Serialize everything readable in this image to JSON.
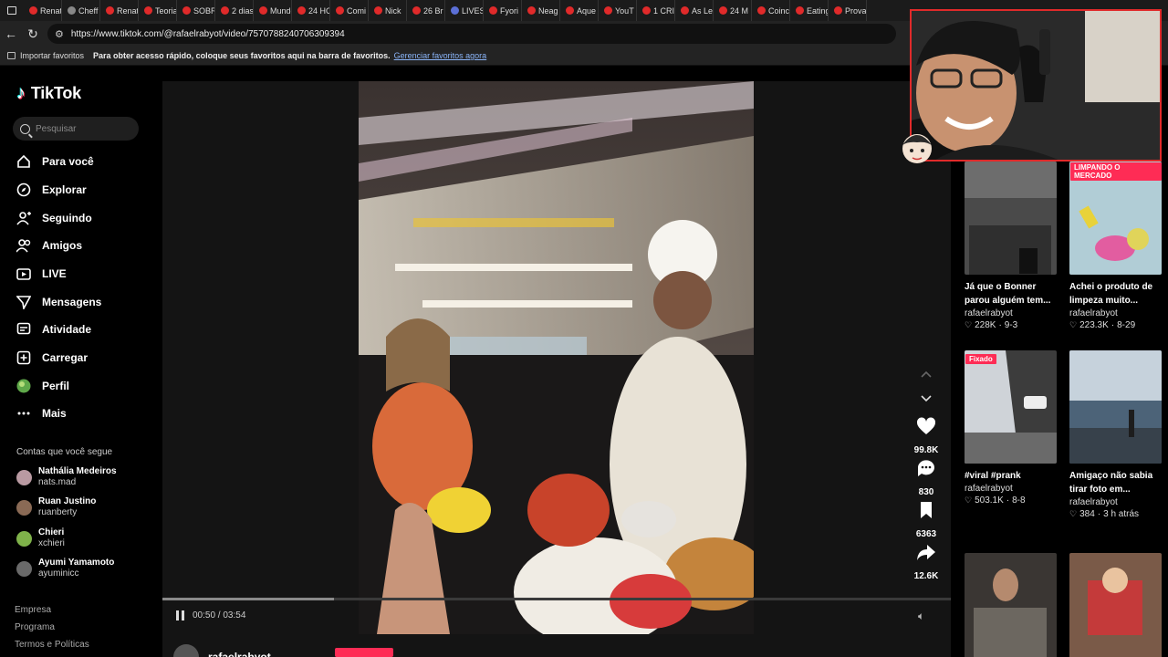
{
  "browser": {
    "tabs": [
      {
        "label": "Renat",
        "color": "#e02a2a"
      },
      {
        "label": "Cheff",
        "color": "#888888"
      },
      {
        "label": "Renat",
        "color": "#e02a2a"
      },
      {
        "label": "Teoria",
        "color": "#e02a2a"
      },
      {
        "label": "SOBR",
        "color": "#e02a2a"
      },
      {
        "label": "2 dias",
        "color": "#e02a2a"
      },
      {
        "label": "Mundo",
        "color": "#e02a2a"
      },
      {
        "label": "24 HO",
        "color": "#e02a2a"
      },
      {
        "label": "Comi",
        "color": "#e02a2a"
      },
      {
        "label": "Nick",
        "color": "#e02a2a"
      },
      {
        "label": "26 Br",
        "color": "#e02a2a"
      },
      {
        "label": "LIVES",
        "color": "#5b6fd6"
      },
      {
        "label": "Fyori",
        "color": "#e02a2a"
      },
      {
        "label": "Neag",
        "color": "#e02a2a"
      },
      {
        "label": "Aque",
        "color": "#e02a2a"
      },
      {
        "label": "YouT",
        "color": "#e02a2a"
      },
      {
        "label": "1 CRI",
        "color": "#e02a2a"
      },
      {
        "label": "As Le",
        "color": "#e02a2a"
      },
      {
        "label": "24 M",
        "color": "#e02a2a"
      },
      {
        "label": "Coinc",
        "color": "#e02a2a"
      },
      {
        "label": "Eating",
        "color": "#e02a2a"
      },
      {
        "label": "Prova",
        "color": "#e02a2a"
      }
    ],
    "url": "https://www.tiktok.com/@rafaelrabyot/video/7570788240706309394",
    "bookmarks": {
      "import_label": "Importar favoritos",
      "prompt": "Para obter acesso rápido, coloque seus favoritos aqui na barra de favoritos.",
      "manage_link": "Gerenciar favoritos agora"
    }
  },
  "sidebar": {
    "brand": "TikTok",
    "search_placeholder": "Pesquisar",
    "nav": [
      {
        "label": "Para você",
        "icon": "home-icon"
      },
      {
        "label": "Explorar",
        "icon": "compass-icon"
      },
      {
        "label": "Seguindo",
        "icon": "user-follow-icon"
      },
      {
        "label": "Amigos",
        "icon": "friends-icon"
      },
      {
        "label": "LIVE",
        "icon": "live-tv-icon"
      },
      {
        "label": "Mensagens",
        "icon": "send-icon"
      },
      {
        "label": "Atividade",
        "icon": "activity-icon"
      },
      {
        "label": "Carregar",
        "icon": "upload-plus-icon"
      },
      {
        "label": "Perfil",
        "icon": "profile-avatar-icon"
      },
      {
        "label": "Mais",
        "icon": "more-dots-icon"
      }
    ],
    "following_title": "Contas que você segue",
    "following": [
      {
        "name": "Nathália Medeiros",
        "username": "nats.mad",
        "color": "#b99aa2"
      },
      {
        "name": "Ruan Justino",
        "username": "ruanberty",
        "color": "#8a6a55"
      },
      {
        "name": "Chieri",
        "username": "xchieri",
        "color": "#7fb24a"
      },
      {
        "name": "Ayumi Yamamoto",
        "username": "ayuminicc",
        "color": "#6a6a6a"
      }
    ],
    "footer": [
      "Empresa",
      "Programa",
      "Termos e Políticas"
    ]
  },
  "player": {
    "time": "00:50 / 03:54",
    "progress": 0.218,
    "author": "rafaelrabyot"
  },
  "actions": [
    {
      "icon": "heart-icon",
      "count": "99.8K"
    },
    {
      "icon": "comment-icon",
      "count": "830"
    },
    {
      "icon": "bookmark-icon",
      "count": "6363"
    },
    {
      "icon": "share-icon",
      "count": "12.6K"
    }
  ],
  "videos": [
    {
      "title": "Já que o Bonner parou alguém tem...",
      "author": "rafaelrabyot",
      "likes": "228K",
      "date": "9-3",
      "badge": "",
      "overlay": ""
    },
    {
      "title": "Achei o produto de limpeza muito...",
      "author": "rafaelrabyot",
      "likes": "223.3K",
      "date": "8-29",
      "badge": "",
      "overlay": "LIMPANDO O MERCADO"
    },
    {
      "title": "#viral #prank",
      "author": "rafaelrabyot",
      "likes": "503.1K",
      "date": "8-8",
      "badge": "Fixado",
      "overlay": ""
    },
    {
      "title": "Amigaço não sabia tirar foto em...",
      "author": "rafaelrabyot",
      "likes": "384",
      "date": "3 h atrás",
      "badge": "",
      "overlay": ""
    }
  ],
  "colors": {
    "accent": "#fe2c55",
    "webcam_border": "#e02a2a"
  }
}
